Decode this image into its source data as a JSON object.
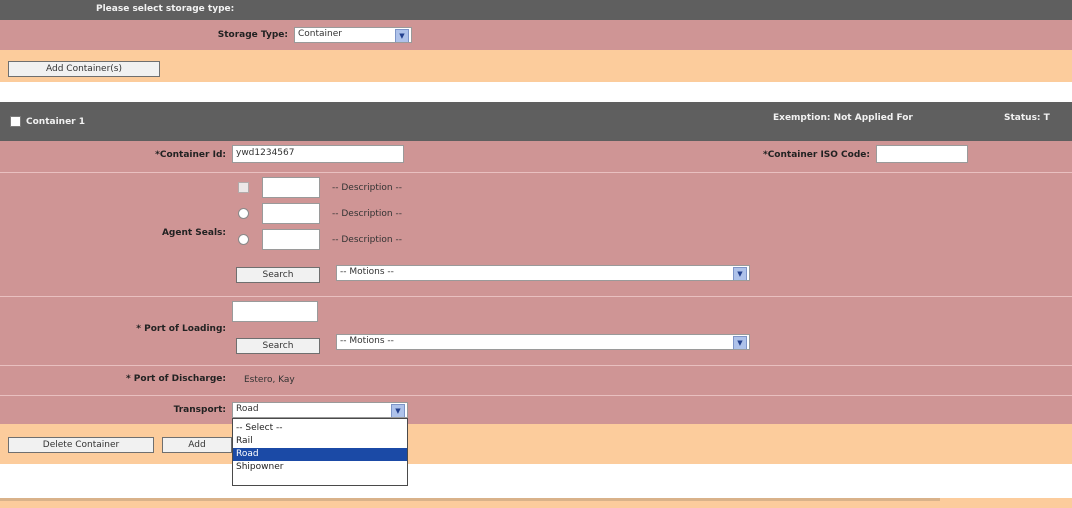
{
  "storage_section": {
    "header": "Please select storage type:",
    "storage_type_label": "Storage Type:",
    "storage_type_value": "Container"
  },
  "add_container_button": "Add Container(s)",
  "container": {
    "header_title": "Container 1",
    "exemption_text": "Exemption: Not Applied For",
    "status_text": "Status: T",
    "container_id_label": "*Container Id:",
    "container_id_value": "ywd1234567",
    "iso_code_label": "*Container ISO Code:",
    "iso_code_value": "",
    "agent_seals_label": "Agent Seals:",
    "seals": [
      {
        "value": "",
        "description": "-- Description --"
      },
      {
        "value": "",
        "description": "-- Description --"
      },
      {
        "value": "",
        "description": "-- Description --"
      }
    ],
    "search_button_label": "Search",
    "agent_select_value": "-- Motions --",
    "port_of_loading_label": "* Port of Loading:",
    "port_of_loading_input": "",
    "port_select_value": "-- Motions --",
    "port_of_discharge_label": "* Port of Discharge:",
    "port_of_discharge_value": "Estero, Kay",
    "transport_label": "Transport:",
    "transport_value": "Road",
    "transport_options": [
      "-- Select --",
      "Rail",
      "Road",
      "Shipowner"
    ],
    "transport_selected_index": 2
  },
  "delete_container_button": "Delete Container",
  "add_button": "Add",
  "colors": {
    "dark_bar": "#5f5f5f",
    "pink_row": "#cf9595",
    "peach_row": "#fccc9c",
    "highlight": "#1b4aa6"
  }
}
